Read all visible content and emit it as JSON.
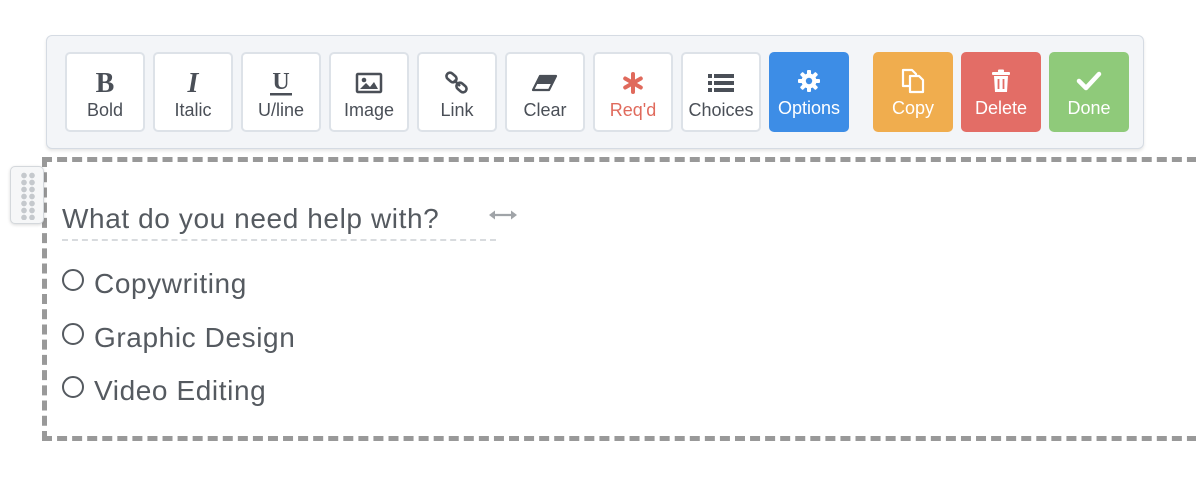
{
  "toolbar": {
    "buttons": [
      {
        "label": "Bold",
        "icon": "bold-icon"
      },
      {
        "label": "Italic",
        "icon": "italic-icon"
      },
      {
        "label": "U/line",
        "icon": "underline-icon"
      },
      {
        "label": "Image",
        "icon": "image-icon"
      },
      {
        "label": "Link",
        "icon": "link-icon"
      },
      {
        "label": "Clear",
        "icon": "eraser-icon"
      },
      {
        "label": "Req'd",
        "icon": "asterisk-icon"
      },
      {
        "label": "Choices",
        "icon": "list-icon"
      },
      {
        "label": "Options",
        "icon": "gear-icon",
        "color": "#3d8de6"
      },
      {
        "label": "Copy",
        "icon": "copy-icon",
        "color": "#f0ad4e"
      },
      {
        "label": "Delete",
        "icon": "trash-icon",
        "color": "#e36d66"
      },
      {
        "label": "Done",
        "icon": "check-icon",
        "color": "#8fca7a"
      }
    ]
  },
  "field": {
    "question": "What do you need help with?",
    "choices": [
      {
        "label": "Copywriting"
      },
      {
        "label": "Graphic Design"
      },
      {
        "label": "Video Editing"
      }
    ]
  }
}
